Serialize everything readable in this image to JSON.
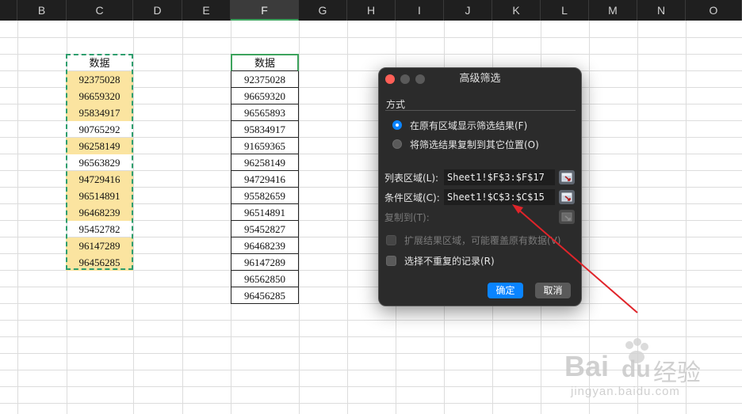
{
  "columns": [
    "B",
    "C",
    "D",
    "E",
    "F",
    "G",
    "H",
    "I",
    "J",
    "K",
    "L",
    "M",
    "N",
    "O"
  ],
  "active_column": "F",
  "column_c": {
    "header": "数据",
    "values": [
      "92375028",
      "96659320",
      "95834917",
      "90765292",
      "96258149",
      "96563829",
      "94729416",
      "96514891",
      "96468239",
      "95452782",
      "96147289",
      "96456285"
    ],
    "highlighted": [
      true,
      true,
      true,
      false,
      true,
      false,
      true,
      true,
      true,
      false,
      true,
      true
    ]
  },
  "column_f": {
    "header": "数据",
    "values": [
      "92375028",
      "96659320",
      "96565893",
      "95834917",
      "91659365",
      "96258149",
      "94729416",
      "95582659",
      "96514891",
      "95452827",
      "96468239",
      "96147289",
      "96562850",
      "96456285"
    ]
  },
  "colors": {
    "highlight": "#fbe4a0",
    "marquee": "#2e9e6e",
    "dialog_bg": "#2b2b2b",
    "primary_button": "#0a84ff",
    "arrow": "#e0242a"
  },
  "dialog": {
    "title": "高级筛选",
    "section": "方式",
    "option1": "在原有区域显示筛选结果(F)",
    "option2": "将筛选结果复制到其它位置(O)",
    "list_range_label": "列表区域(L):",
    "list_range_value": "Sheet1!$F$3:$F$17",
    "criteria_range_label": "条件区域(C):",
    "criteria_range_value": "Sheet1!$C$3:$C$15",
    "copy_to_label": "复制到(T):",
    "copy_to_value": "",
    "extend_label": "扩展结果区域，可能覆盖原有数据(V)",
    "unique_label": "选择不重复的记录(R)",
    "ok": "确定",
    "cancel": "取消"
  },
  "watermark": {
    "brand": "Bai",
    "brand2": "du",
    "service": "经验",
    "url": "jingyan.baidu.com"
  }
}
